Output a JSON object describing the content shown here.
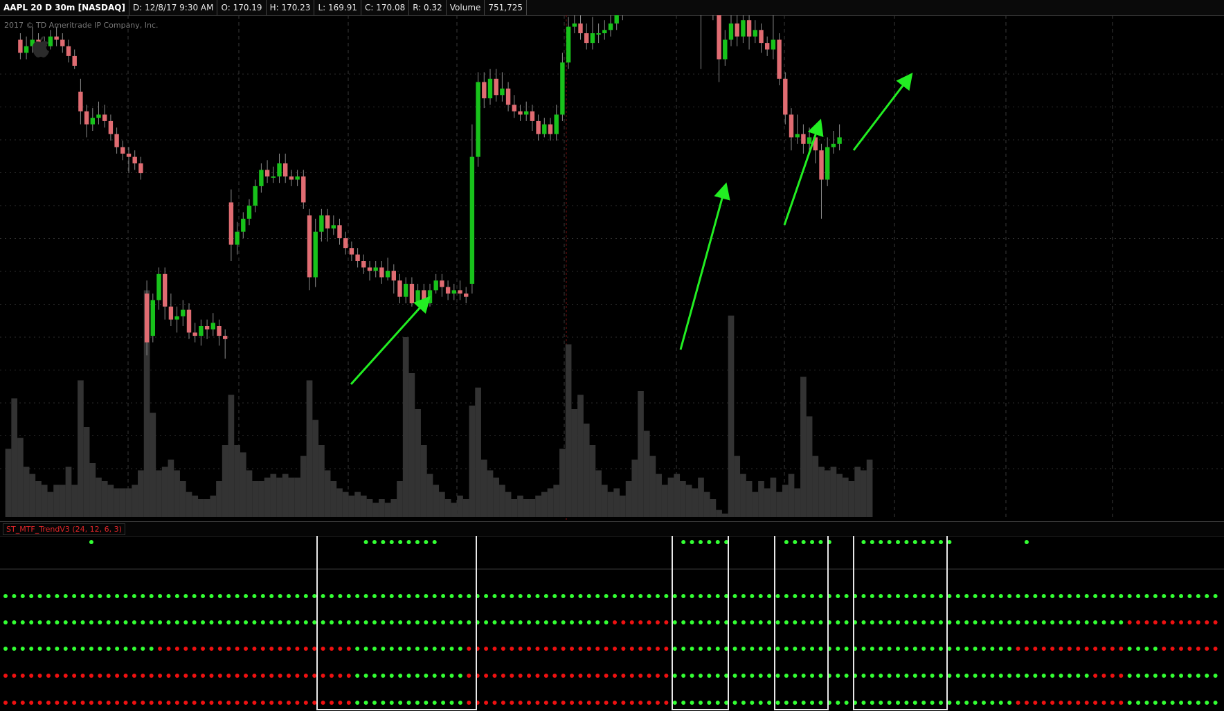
{
  "header": {
    "symbol": "AAPL 20 D 30m [NASDAQ]",
    "date": "D: 12/8/17 9:30 AM",
    "open": "O: 170.19",
    "high": "H: 170.23",
    "low": "L: 169.91",
    "close": "C: 170.08",
    "range": "R: 0.32",
    "volume_label": "Volume",
    "volume_value": "751,725"
  },
  "copyright": "2017 © TD Ameritrade IP Company, Inc.",
  "icons": {
    "logo": "apple-logo-icon"
  },
  "colors": {
    "up": "#18c21b",
    "down": "#e06c72",
    "volume": "#333333",
    "arrow": "#22ee22",
    "dot_green": "#33ff33",
    "dot_red": "#ee1111"
  },
  "indicator": {
    "title": "ST_MTF_TrendV3 (24, 12, 6, 3)"
  },
  "chart_data": {
    "type": "candlestick",
    "price_panel": {
      "bars": [
        [
          8.0,
          7.2,
          8.2,
          7.0
        ],
        [
          7.2,
          6.8,
          7.6,
          6.6
        ],
        [
          5.8,
          5.4,
          6.0,
          5.2
        ],
        [
          5.4,
          5.6,
          5.9,
          5.2
        ],
        [
          5.6,
          5.8,
          6.2,
          5.4
        ],
        [
          5.8,
          5.7,
          6.0,
          5.5
        ],
        [
          5.7,
          5.6,
          5.9,
          5.4
        ],
        [
          5.6,
          5.9,
          6.1,
          5.5
        ],
        [
          5.9,
          5.8,
          6.2,
          5.6
        ],
        [
          5.8,
          5.6,
          6.0,
          5.4
        ],
        [
          5.6,
          5.3,
          5.8,
          5.1
        ],
        [
          5.3,
          5.0,
          5.5,
          4.9
        ],
        [
          4.2,
          3.6,
          4.6,
          3.2
        ],
        [
          3.6,
          3.2,
          3.8,
          2.8
        ],
        [
          3.2,
          3.4,
          3.7,
          3.0
        ],
        [
          3.4,
          3.5,
          3.9,
          3.2
        ],
        [
          3.5,
          3.3,
          3.8,
          3.1
        ],
        [
          3.3,
          2.9,
          3.5,
          2.7
        ],
        [
          2.9,
          2.5,
          3.1,
          2.3
        ],
        [
          2.5,
          2.3,
          2.7,
          2.1
        ],
        [
          2.3,
          2.2,
          2.5,
          1.7
        ],
        [
          2.2,
          2.0,
          2.4,
          1.8
        ],
        [
          2.0,
          1.7,
          2.2,
          1.5
        ],
        [
          -2.0,
          -3.5,
          -1.6,
          -3.9
        ],
        [
          -3.3,
          -2.2,
          -2.0,
          -3.5
        ],
        [
          -2.2,
          -1.4,
          -1.2,
          -2.5
        ],
        [
          -1.4,
          -2.4,
          -1.2,
          -2.8
        ],
        [
          -2.4,
          -2.8,
          -2.0,
          -3.0
        ],
        [
          -2.8,
          -2.7,
          -2.4,
          -3.2
        ],
        [
          -2.7,
          -2.5,
          -2.2,
          -3.0
        ],
        [
          -2.5,
          -3.2,
          -2.3,
          -3.4
        ],
        [
          -3.2,
          -3.3,
          -2.9,
          -3.5
        ],
        [
          -3.3,
          -3.0,
          -2.8,
          -3.6
        ],
        [
          -3.0,
          -3.1,
          -2.8,
          -3.4
        ],
        [
          -3.1,
          -2.9,
          -2.6,
          -3.3
        ],
        [
          -3.0,
          -3.3,
          -2.8,
          -3.6
        ],
        [
          -3.3,
          -3.4,
          -3.1,
          -4.0
        ],
        [
          0.8,
          -0.5,
          1.2,
          -1.0
        ],
        [
          -0.5,
          -0.1,
          0.2,
          -0.8
        ],
        [
          -0.1,
          0.3,
          0.5,
          -0.3
        ],
        [
          0.3,
          0.7,
          0.9,
          0.1
        ],
        [
          0.7,
          1.3,
          1.5,
          0.5
        ],
        [
          1.3,
          1.8,
          2.0,
          1.1
        ],
        [
          1.8,
          1.6,
          2.1,
          1.4
        ],
        [
          1.6,
          1.6,
          1.9,
          1.4
        ],
        [
          1.6,
          2.0,
          2.3,
          1.4
        ],
        [
          2.0,
          1.6,
          2.3,
          1.4
        ],
        [
          1.6,
          1.5,
          1.8,
          1.3
        ],
        [
          1.5,
          1.6,
          1.8,
          1.3
        ],
        [
          1.6,
          0.8,
          1.8,
          0.6
        ],
        [
          0.4,
          -1.5,
          0.6,
          -1.9
        ],
        [
          -1.5,
          -0.1,
          0.3,
          -1.8
        ],
        [
          -0.1,
          0.4,
          0.6,
          -0.4
        ],
        [
          0.4,
          0.0,
          0.6,
          -0.4
        ],
        [
          0.0,
          0.1,
          0.4,
          -0.2
        ],
        [
          0.1,
          -0.3,
          0.3,
          -0.5
        ],
        [
          -0.3,
          -0.6,
          -0.1,
          -0.8
        ],
        [
          -0.6,
          -0.8,
          -0.4,
          -1.0
        ],
        [
          -0.8,
          -1.0,
          -0.6,
          -1.2
        ],
        [
          -1.0,
          -1.2,
          -0.8,
          -1.4
        ],
        [
          -1.2,
          -1.3,
          -1.0,
          -1.6
        ],
        [
          -1.3,
          -1.2,
          -1.0,
          -1.5
        ],
        [
          -1.2,
          -1.5,
          -1.0,
          -1.7
        ],
        [
          -1.5,
          -1.3,
          -0.9,
          -1.6
        ],
        [
          -1.3,
          -1.6,
          -1.1,
          -2.0
        ],
        [
          -1.6,
          -2.1,
          -1.4,
          -2.3
        ],
        [
          -2.1,
          -1.7,
          -1.5,
          -2.3
        ],
        [
          -1.7,
          -2.3,
          -1.5,
          -2.4
        ],
        [
          -2.3,
          -1.9,
          -1.7,
          -2.4
        ],
        [
          -1.9,
          -2.3,
          -1.7,
          -2.5
        ],
        [
          -2.3,
          -1.9,
          -1.7,
          -2.4
        ],
        [
          -1.9,
          -1.6,
          -1.4,
          -2.0
        ],
        [
          -1.6,
          -1.8,
          -1.4,
          -2.1
        ],
        [
          -1.8,
          -2.0,
          -1.6,
          -2.2
        ],
        [
          -2.0,
          -1.9,
          -1.7,
          -2.2
        ],
        [
          -1.9,
          -2.0,
          -1.6,
          -2.2
        ],
        [
          -2.0,
          -2.1,
          -1.8,
          -2.3
        ],
        [
          -1.7,
          2.2,
          3.2,
          -2.0
        ],
        [
          2.2,
          4.5,
          4.8,
          1.9
        ],
        [
          4.5,
          4.0,
          4.8,
          3.7
        ],
        [
          4.0,
          4.6,
          4.9,
          3.8
        ],
        [
          4.6,
          4.1,
          4.9,
          3.9
        ],
        [
          4.1,
          4.3,
          4.8,
          3.9
        ],
        [
          4.3,
          3.8,
          4.5,
          3.6
        ],
        [
          3.8,
          3.6,
          4.1,
          3.4
        ],
        [
          3.6,
          3.5,
          3.8,
          3.3
        ],
        [
          3.5,
          3.6,
          3.9,
          3.3
        ],
        [
          3.6,
          3.3,
          3.8,
          3.0
        ],
        [
          3.3,
          2.9,
          3.5,
          2.7
        ],
        [
          2.9,
          3.2,
          3.4,
          2.8
        ],
        [
          3.2,
          2.9,
          3.4,
          2.7
        ],
        [
          2.9,
          3.5,
          3.8,
          2.7
        ],
        [
          3.5,
          5.1,
          5.4,
          3.3
        ],
        [
          5.1,
          6.2,
          6.5,
          4.9
        ],
        [
          6.2,
          6.3,
          7.5,
          6.0
        ],
        [
          6.3,
          6.0,
          6.6,
          5.8
        ],
        [
          6.0,
          5.7,
          6.3,
          5.5
        ],
        [
          5.7,
          6.0,
          6.5,
          5.5
        ],
        [
          6.0,
          6.0,
          6.3,
          5.7
        ],
        [
          6.0,
          6.1,
          6.4,
          5.8
        ],
        [
          6.1,
          6.3,
          6.6,
          5.9
        ],
        [
          6.3,
          6.6,
          6.9,
          6.1
        ],
        [
          6.6,
          7.0,
          7.5,
          6.4
        ],
        [
          7.0,
          8.3,
          8.6,
          6.8
        ],
        [
          8.3,
          8.7,
          9.5,
          8.1
        ],
        [
          8.7,
          8.4,
          9.0,
          8.2
        ],
        [
          8.4,
          8.2,
          8.7,
          8.0
        ],
        [
          8.2,
          8.5,
          8.8,
          7.9
        ],
        [
          8.5,
          8.3,
          8.7,
          8.1
        ],
        [
          8.3,
          8.1,
          8.5,
          7.9
        ],
        [
          8.1,
          8.0,
          8.3,
          7.8
        ],
        [
          8.0,
          7.8,
          8.2,
          7.6
        ],
        [
          7.8,
          7.9,
          8.1,
          7.6
        ],
        [
          7.9,
          7.7,
          8.1,
          7.5
        ],
        [
          7.7,
          8.0,
          8.2,
          7.5
        ],
        [
          8.2,
          7.3,
          8.4,
          4.9
        ],
        [
          7.3,
          7.2,
          7.6,
          6.9
        ],
        [
          7.2,
          6.7,
          7.4,
          6.4
        ],
        [
          6.7,
          5.2,
          6.9,
          4.5
        ],
        [
          5.2,
          5.8,
          6.1,
          5.0
        ],
        [
          5.8,
          6.3,
          6.6,
          5.6
        ],
        [
          6.3,
          5.9,
          6.7,
          5.6
        ],
        [
          5.9,
          6.4,
          6.7,
          5.7
        ],
        [
          6.4,
          5.9,
          6.6,
          5.5
        ],
        [
          5.9,
          6.1,
          6.4,
          5.7
        ],
        [
          6.1,
          5.7,
          6.3,
          5.4
        ],
        [
          5.7,
          5.5,
          5.9,
          5.3
        ],
        [
          5.5,
          5.8,
          7.2,
          5.2
        ],
        [
          5.8,
          4.6,
          6.0,
          4.4
        ],
        [
          4.6,
          3.5,
          4.8,
          3.2
        ],
        [
          3.5,
          2.8,
          3.7,
          2.4
        ],
        [
          2.8,
          2.9,
          3.5,
          2.6
        ],
        [
          2.9,
          2.6,
          3.2,
          2.3
        ],
        [
          2.6,
          2.8,
          3.1,
          2.4
        ],
        [
          2.8,
          2.4,
          3.0,
          2.0
        ],
        [
          2.4,
          1.5,
          2.6,
          0.3
        ],
        [
          1.5,
          2.5,
          2.8,
          1.3
        ],
        [
          2.5,
          2.6,
          3.0,
          2.3
        ],
        [
          2.6,
          2.8,
          3.2,
          2.4
        ]
      ],
      "volumes": [
        0.19,
        0.33,
        0.22,
        0.14,
        0.12,
        0.1,
        0.09,
        0.07,
        0.09,
        0.09,
        0.14,
        0.09,
        0.38,
        0.25,
        0.15,
        0.11,
        0.1,
        0.09,
        0.08,
        0.08,
        0.08,
        0.09,
        0.13,
        0.63,
        0.29,
        0.13,
        0.14,
        0.16,
        0.13,
        0.1,
        0.07,
        0.06,
        0.05,
        0.05,
        0.06,
        0.1,
        0.2,
        0.34,
        0.2,
        0.18,
        0.13,
        0.1,
        0.1,
        0.11,
        0.12,
        0.11,
        0.12,
        0.11,
        0.11,
        0.17,
        0.38,
        0.27,
        0.2,
        0.13,
        0.1,
        0.08,
        0.07,
        0.06,
        0.07,
        0.06,
        0.05,
        0.04,
        0.05,
        0.04,
        0.05,
        0.1,
        0.5,
        0.4,
        0.3,
        0.2,
        0.12,
        0.09,
        0.07,
        0.05,
        0.04,
        0.06,
        0.05,
        0.31,
        0.36,
        0.16,
        0.13,
        0.11,
        0.09,
        0.07,
        0.05,
        0.06,
        0.05,
        0.05,
        0.06,
        0.07,
        0.08,
        0.09,
        0.19,
        0.48,
        0.3,
        0.34,
        0.26,
        0.2,
        0.13,
        0.09,
        0.07,
        0.08,
        0.06,
        0.1,
        0.16,
        0.35,
        0.24,
        0.17,
        0.12,
        0.09,
        0.11,
        0.12,
        0.1,
        0.09,
        0.08,
        0.11,
        0.07,
        0.05,
        0.02,
        0.01,
        0.56,
        0.17,
        0.12,
        0.1,
        0.07,
        0.1,
        0.08,
        0.11,
        0.07,
        0.09,
        0.12,
        0.08,
        0.39,
        0.28,
        0.17,
        0.14,
        0.13,
        0.14,
        0.12,
        0.11,
        0.1,
        0.14,
        0.13,
        0.16
      ]
    },
    "indicator_panel": {
      "title": "ST_MTF_TrendV3 (24, 12, 6, 3)",
      "count": 142,
      "row0_green_dots": [
        10,
        42,
        43,
        44,
        45,
        46,
        47,
        48,
        49,
        50,
        79,
        80,
        81,
        82,
        83,
        84,
        91,
        92,
        93,
        94,
        95,
        96,
        100,
        101,
        102,
        103,
        104,
        105,
        106,
        107,
        108,
        109,
        110,
        119
      ],
      "rows": [
        {
          "red": []
        },
        {
          "red": [
            [
              71,
              77
            ],
            [
              131,
              142
            ]
          ]
        },
        {
          "red": [
            [
              18,
              40
            ],
            [
              54,
              77
            ],
            [
              118,
              130
            ],
            [
              135,
              142
            ]
          ]
        },
        {
          "red": [
            [
              0,
              40
            ],
            [
              54,
              77
            ],
            [
              127,
              130
            ]
          ]
        },
        {
          "red": [
            [
              0,
              40
            ],
            [
              54,
              77
            ],
            [
              118,
              130
            ]
          ]
        }
      ]
    }
  }
}
